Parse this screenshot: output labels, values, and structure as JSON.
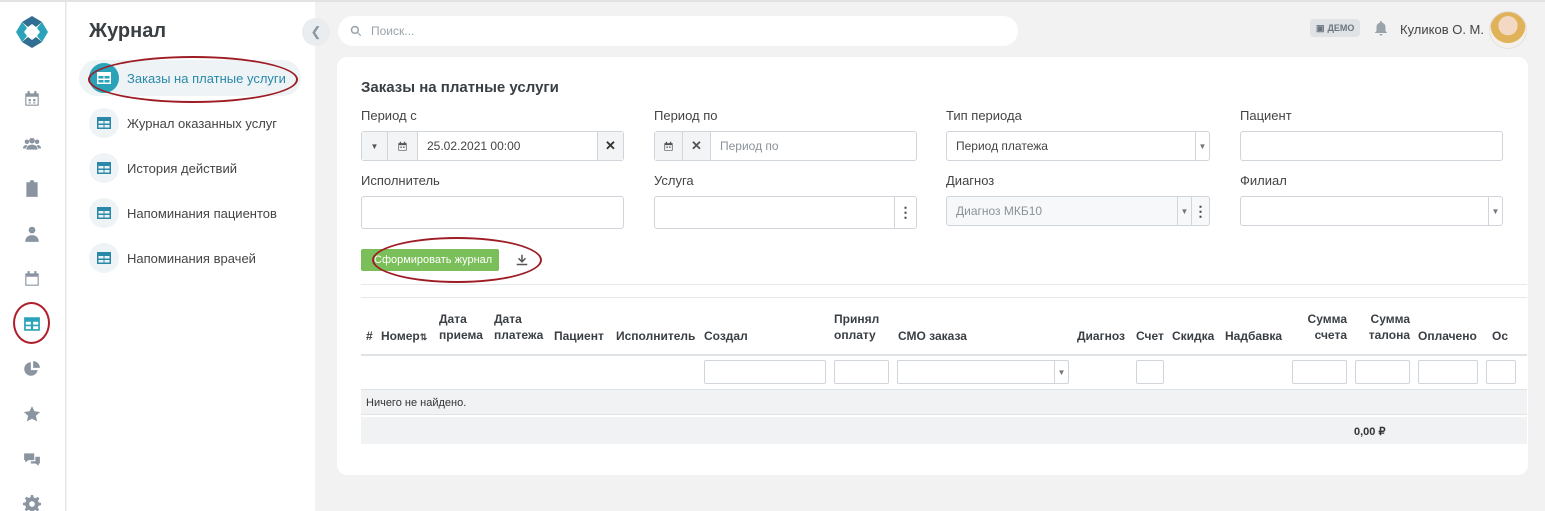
{
  "colors": {
    "accent": "#2aa3b8",
    "button_green": "#7bbf5a",
    "annotation_red": "#a01c24"
  },
  "rail": {
    "icons": [
      "calendar-icon",
      "users-icon",
      "clipboard-icon",
      "doctor-icon",
      "schedule-icon",
      "table-icon",
      "pie-chart-icon",
      "star-icon",
      "chat-icon",
      "settings-icon"
    ],
    "active": "table-icon"
  },
  "journal": {
    "title": "Журнал",
    "items": [
      {
        "label": "Заказы на платные услуги",
        "active": true
      },
      {
        "label": "Журнал оказанных услуг"
      },
      {
        "label": "История действий"
      },
      {
        "label": "Напоминания пациентов"
      },
      {
        "label": "Напоминания врачей"
      }
    ]
  },
  "topbar": {
    "search_placeholder": "Поиск...",
    "demo_badge": "ДЕМО",
    "user_name": "Куликов О. М."
  },
  "report": {
    "title": "Заказы на платные услуги",
    "filters": {
      "period_from": {
        "label": "Период с",
        "value": "25.02.2021 00:00"
      },
      "period_to": {
        "label": "Период по",
        "placeholder": "Период по"
      },
      "period_type": {
        "label": "Тип периода",
        "value": "Период платежа"
      },
      "patient": {
        "label": "Пациент",
        "value": ""
      },
      "performer": {
        "label": "Исполнитель",
        "value": ""
      },
      "service": {
        "label": "Услуга",
        "value": ""
      },
      "diagnosis": {
        "label": "Диагноз",
        "placeholder": "Диагноз МКБ10"
      },
      "branch": {
        "label": "Филиал",
        "value": ""
      }
    },
    "generate_button": "Сформировать журнал",
    "table": {
      "columns": [
        "#",
        "Номер",
        "Дата приема",
        "Дата платежа",
        "Пациент",
        "Исполнитель",
        "Создал",
        "Принял оплату",
        "СМО заказа",
        "Диагноз",
        "Счет",
        "Скидка",
        "Надбавка",
        "Сумма счета",
        "Сумма талона",
        "Оплачено",
        "Ос"
      ],
      "empty_text": "Ничего не найдено.",
      "total_talon": "0,00 ₽"
    }
  }
}
